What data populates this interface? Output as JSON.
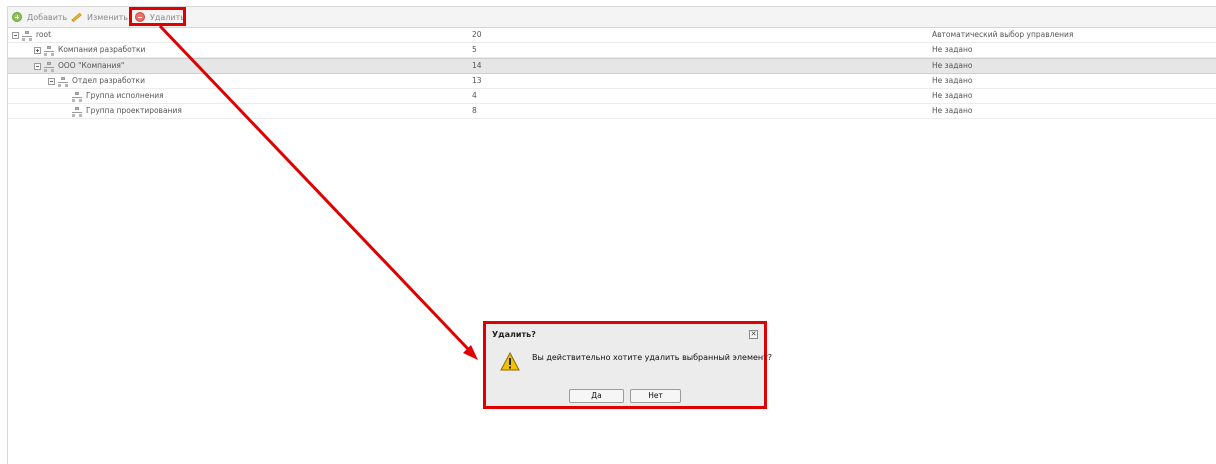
{
  "toolbar": {
    "add_label": "Добавить",
    "edit_label": "Изменить",
    "delete_label": "Удалить"
  },
  "tree": {
    "rows": [
      {
        "name": "root",
        "count": "20",
        "mode": "Автоматический выбор управления"
      },
      {
        "name": "Компания разработки",
        "count": "5",
        "mode": "Не задано"
      },
      {
        "name": "ООО \"Компания\"",
        "count": "14",
        "mode": "Не задано"
      },
      {
        "name": "Отдел разработки",
        "count": "13",
        "mode": "Не задано"
      },
      {
        "name": "Группа исполнения",
        "count": "4",
        "mode": "Не задано"
      },
      {
        "name": "Группа проектирования",
        "count": "8",
        "mode": "Не задано"
      }
    ]
  },
  "dialog": {
    "title": "Удалить?",
    "message": "Вы действительно хотите удалить выбранный элемент?",
    "yes_label": "Да",
    "no_label": "Нет",
    "close_glyph": "✕"
  },
  "colors": {
    "highlight": "#e00000",
    "selected_row": "#e6e6e6",
    "warning": "#f2c200"
  }
}
